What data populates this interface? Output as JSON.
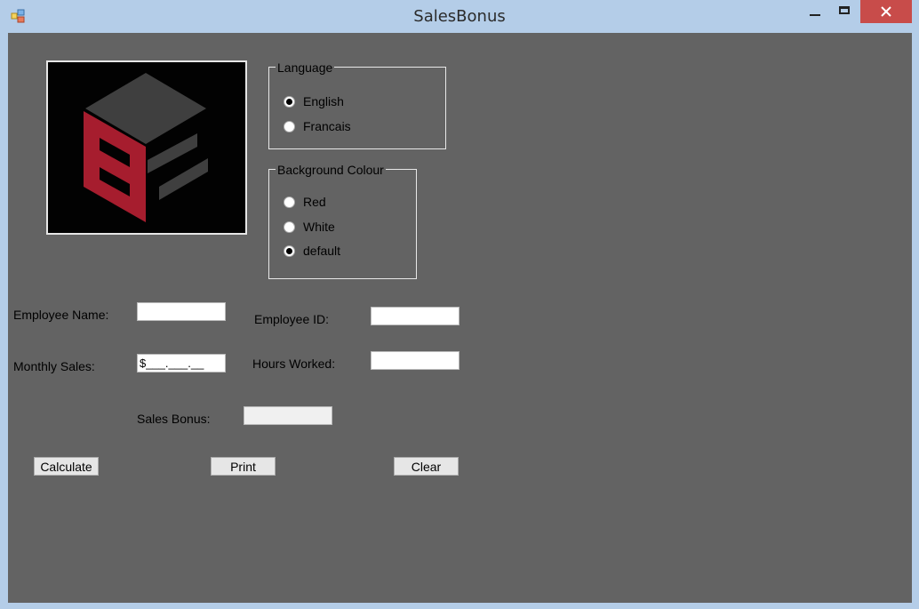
{
  "window": {
    "title": "SalesBonus"
  },
  "language_group": {
    "legend": "Language",
    "options": [
      {
        "label": "English",
        "checked": true
      },
      {
        "label": "Francais",
        "checked": false
      }
    ]
  },
  "background_group": {
    "legend": "Background Colour",
    "options": [
      {
        "label": "Red",
        "checked": false
      },
      {
        "label": "White",
        "checked": false
      },
      {
        "label": "default",
        "checked": true
      }
    ]
  },
  "form": {
    "employee_name_label": "Employee Name:",
    "employee_name_value": "",
    "employee_id_label": "Employee ID:",
    "employee_id_value": "",
    "monthly_sales_label": "Monthly Sales:",
    "monthly_sales_value": "$___.___.__",
    "hours_worked_label": "Hours Worked:",
    "hours_worked_value": "",
    "sales_bonus_label": "Sales Bonus:",
    "sales_bonus_value": ""
  },
  "buttons": {
    "calculate": "Calculate",
    "print": "Print",
    "clear": "Clear"
  },
  "colors": {
    "client_bg": "#636363",
    "titlebar": "#b4cde8",
    "close": "#c84c4a",
    "logo_red": "#a61d2e",
    "logo_gray": "#3f3f3f"
  }
}
